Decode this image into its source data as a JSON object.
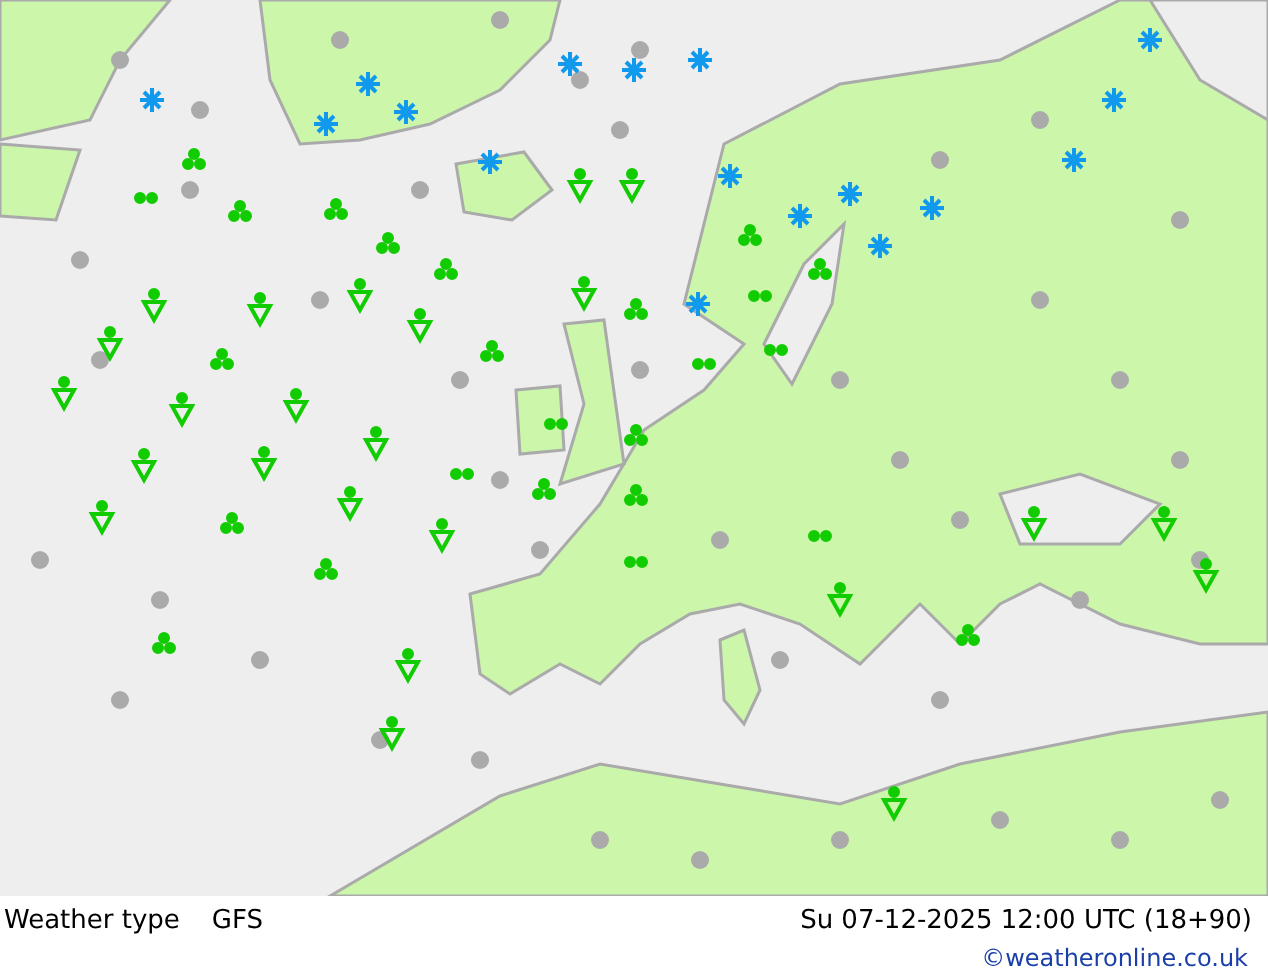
{
  "map": {
    "title": "Weather type",
    "model": "GFS",
    "valid_time": "Su 07-12-2025 12:00 UTC (18+90)",
    "credit": "©weatheronline.co.uk"
  }
}
